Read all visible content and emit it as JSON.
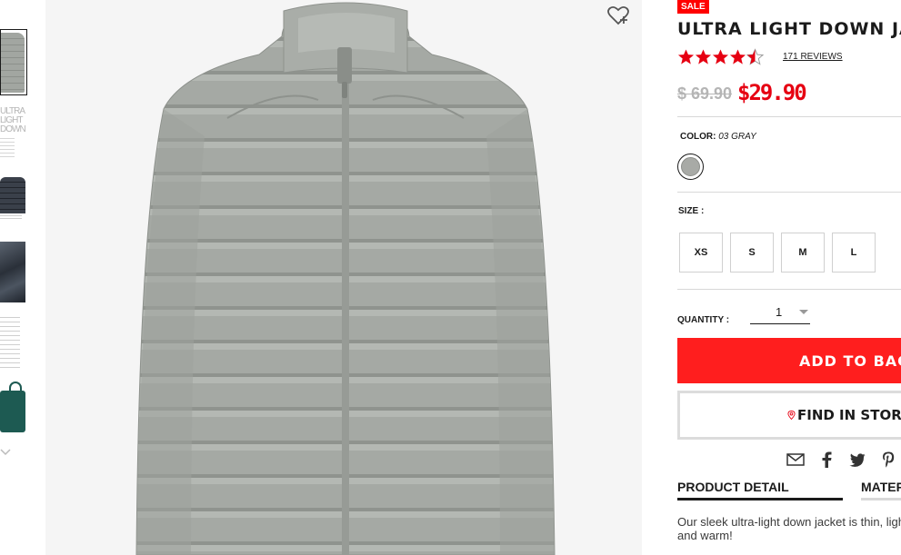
{
  "product": {
    "badge": "SALE",
    "title": "ULTRA LIGHT DOWN JACKET",
    "rating_stars": 4.5,
    "reviews": "171 REVIEWS",
    "price_original": "$ 69.90",
    "price_sale": "$29.90",
    "color_label": "COLOR:",
    "color_value": "03 GRAY",
    "swatch_color": "#a8aaa6",
    "size_label": "SIZE :",
    "sizes": [
      "XS",
      "S",
      "M",
      "L"
    ],
    "quantity_label": "QUANTITY :",
    "quantity_value": "1",
    "add_to_bag": "ADD TO BAG",
    "find_in_store": "FIND IN STORE",
    "tabs": [
      "PRODUCT DETAIL",
      "MATERIALS"
    ],
    "description": "Our sleek ultra-light down jacket is thin, light and warm!"
  },
  "thumbnails": {
    "text_thumb": "ULTRA LIGHT DOWN"
  },
  "share_icons": [
    "email-icon",
    "facebook-icon",
    "twitter-icon",
    "pinterest-icon"
  ],
  "colors": {
    "sale_red": "#ff0000",
    "price_red": "#e60012",
    "button_red": "#ff1e1e",
    "jacket_gray": "#a4a8a3"
  }
}
